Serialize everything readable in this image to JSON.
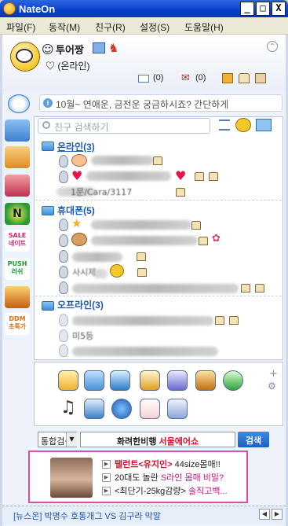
{
  "window": {
    "title": "NateOn",
    "controls": [
      "_",
      "□",
      "X"
    ]
  },
  "menu": [
    "파일(F)",
    "동작(M)",
    "친구(R)",
    "설정(S)",
    "도움말(H)"
  ],
  "profile": {
    "nickname": "투어짱",
    "status": "♡ (온라인)",
    "mail_count": "(0)",
    "memo_count": "(0)"
  },
  "notice": "10월~ 연애운, 금전운 궁금하시죠? 간단하게",
  "search": {
    "placeholder": "친구 검색하기"
  },
  "groups": [
    {
      "label": "온라인(3)"
    },
    {
      "label": "휴대폰(5)"
    },
    {
      "label": "오프라인(3)"
    }
  ],
  "friends_visible_text": [
    "1문/Cara/3117",
    "사시제",
    "미5등"
  ],
  "sidebar": [
    {
      "name": "cyworld",
      "label": ""
    },
    {
      "name": "diary",
      "label": ""
    },
    {
      "name": "game",
      "label": ""
    },
    {
      "name": "nate",
      "label": "N"
    },
    {
      "name": "sale",
      "label": "SALE\n네이트"
    },
    {
      "name": "push",
      "label": "PUSH\n러쉬"
    },
    {
      "name": "movie",
      "label": ""
    },
    {
      "name": "ddm",
      "label": "DDM\n초특가"
    }
  ],
  "apps": [
    "조직대화",
    "문자",
    "전화",
    "메모",
    "화상",
    "파일",
    "보안",
    "음악",
    "카드",
    "네이트",
    "주식",
    "책상"
  ],
  "bottom_search": {
    "combo_label": "통합검색",
    "keyword_prefix": "화려한비행 ",
    "keyword_highlight": "서울에어쇼",
    "button_label": "검색"
  },
  "ad": {
    "line1_a": "탤런트<유지인>",
    "line1_b": " 44size몸매!!",
    "line2_a": "20대도 놀란 ",
    "line2_b": "S라인 몸매 비밀?",
    "line3_a": "<최단기-25kg감량>",
    "line3_b": " 솔직고백..."
  },
  "news": "[뉴스온] 박명수 호통개그 VS 김구라 막말",
  "colors": {
    "title_bar": "#0a3fcb",
    "group_text": "#1d5ab5",
    "ad_border": "#e24aa8",
    "ad_red": "#d8102c",
    "ad_pink": "#c8127e"
  }
}
